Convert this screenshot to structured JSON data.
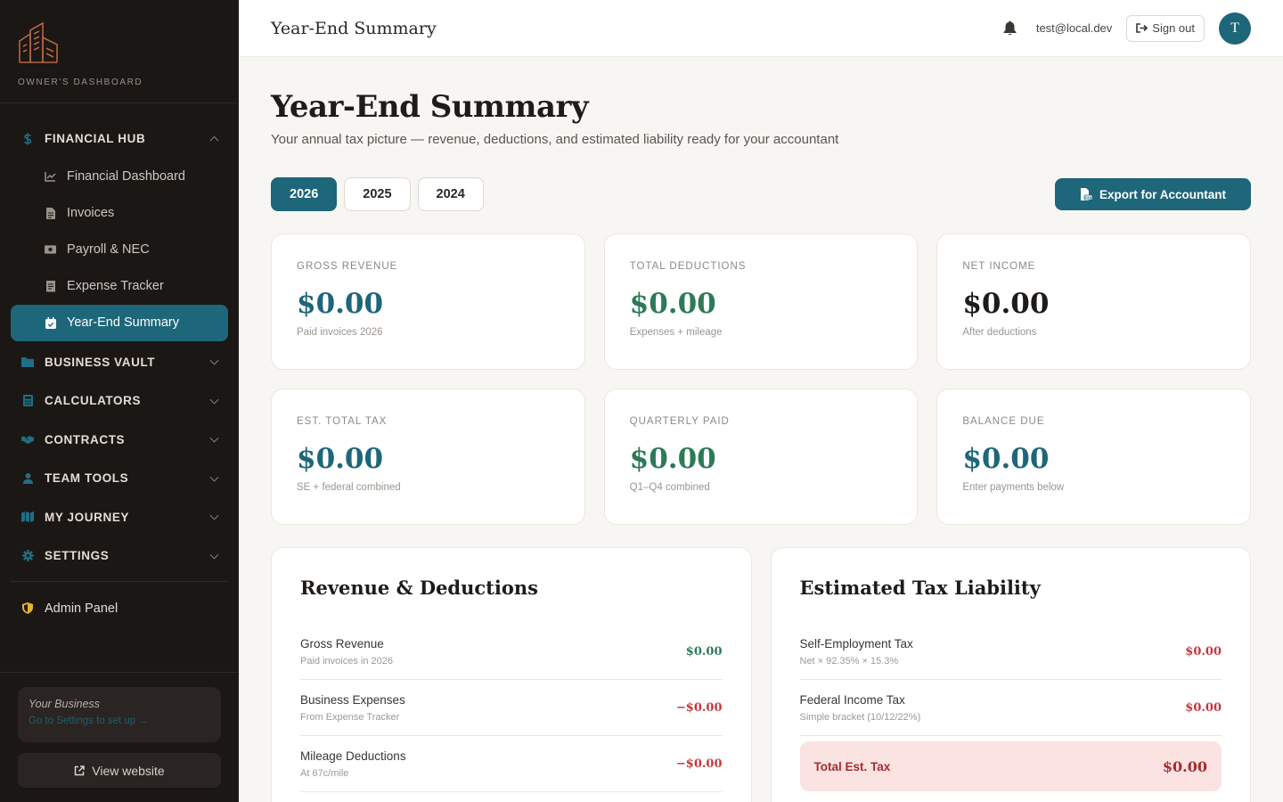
{
  "brand": {
    "label": "OWNER'S DASHBOARD"
  },
  "sidebar": {
    "sections": [
      {
        "label": "FINANCIAL HUB",
        "icon": "dollar-icon",
        "expanded": true,
        "items": [
          {
            "label": "Financial Dashboard",
            "icon": "chart-icon"
          },
          {
            "label": "Invoices",
            "icon": "document-icon"
          },
          {
            "label": "Payroll & NEC",
            "icon": "money-icon"
          },
          {
            "label": "Expense Tracker",
            "icon": "receipt-icon"
          },
          {
            "label": "Year-End Summary",
            "icon": "calendar-check-icon",
            "active": true
          }
        ]
      },
      {
        "label": "BUSINESS VAULT",
        "icon": "folder-icon"
      },
      {
        "label": "CALCULATORS",
        "icon": "calculator-icon"
      },
      {
        "label": "CONTRACTS",
        "icon": "handshake-icon"
      },
      {
        "label": "TEAM TOOLS",
        "icon": "user-icon"
      },
      {
        "label": "MY JOURNEY",
        "icon": "map-icon"
      },
      {
        "label": "SETTINGS",
        "icon": "gear-icon"
      }
    ],
    "admin": {
      "label": "Admin Panel",
      "icon": "shield-icon"
    },
    "footer": {
      "business_name": "Your Business",
      "business_link": "Go to Settings to set up →",
      "view_website": "View website"
    }
  },
  "topbar": {
    "title": "Year-End Summary",
    "email": "test@local.dev",
    "signout": "Sign out",
    "avatar_initial": "T"
  },
  "page": {
    "title": "Year-End Summary",
    "subtitle": "Your annual tax picture — revenue, deductions, and estimated liability ready for your accountant",
    "years": [
      "2026",
      "2025",
      "2024"
    ],
    "active_year": "2026",
    "export_label": "Export for Accountant"
  },
  "cards": [
    {
      "label": "GROSS REVENUE",
      "value": "$0.00",
      "note": "Paid invoices 2026",
      "tone": "teal"
    },
    {
      "label": "TOTAL DEDUCTIONS",
      "value": "$0.00",
      "note": "Expenses + mileage",
      "tone": "green"
    },
    {
      "label": "NET INCOME",
      "value": "$0.00",
      "note": "After deductions",
      "tone": "dark"
    },
    {
      "label": "EST. TOTAL TAX",
      "value": "$0.00",
      "note": "SE + federal combined",
      "tone": "teal"
    },
    {
      "label": "QUARTERLY PAID",
      "value": "$0.00",
      "note": "Q1–Q4 combined",
      "tone": "green"
    },
    {
      "label": "BALANCE DUE",
      "value": "$0.00",
      "note": "Enter payments below",
      "tone": "teal"
    }
  ],
  "revenue_panel": {
    "title": "Revenue & Deductions",
    "rows": [
      {
        "label": "Gross Revenue",
        "note": "Paid invoices in 2026",
        "value": "$0.00",
        "tone": "green"
      },
      {
        "label": "Business Expenses",
        "note": "From Expense Tracker",
        "value": "−$0.00",
        "tone": "red"
      },
      {
        "label": "Mileage Deductions",
        "note": "At 67c/mile",
        "value": "−$0.00",
        "tone": "red"
      }
    ]
  },
  "tax_panel": {
    "title": "Estimated Tax Liability",
    "rows": [
      {
        "label": "Self-Employment Tax",
        "note": "Net × 92.35% × 15.3%",
        "value": "$0.00",
        "tone": "red"
      },
      {
        "label": "Federal Income Tax",
        "note": "Simple bracket (10/12/22%)",
        "value": "$0.00",
        "tone": "red"
      }
    ],
    "total": {
      "label": "Total Est. Tax",
      "value": "$0.00"
    }
  },
  "colors": {
    "accent": "#1e6679",
    "sidebar_bg": "#1b1715",
    "positive": "#2b7a58",
    "negative": "#c4363a",
    "brand_logo": "#b5673f",
    "admin_icon": "#e8b422"
  }
}
